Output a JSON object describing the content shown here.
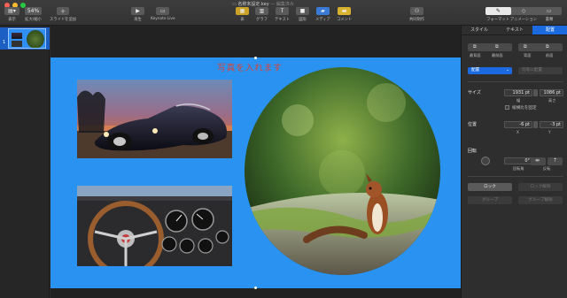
{
  "window": {
    "title": "名称未設定.key",
    "subtitle": "編集済み"
  },
  "toolbar": {
    "view_label": "表示",
    "zoom_value": "54%",
    "zoom_label": "拡大/縮小",
    "add_slide_label": "スライドを追加",
    "play_label": "再生",
    "keynote_live_label": "Keynote Live",
    "table_label": "表",
    "chart_label": "グラフ",
    "text_label": "テキスト",
    "shape_label": "図形",
    "media_label": "メディア",
    "comment_label": "コメント",
    "collaborate_label": "共同制作",
    "format_label": "フォーマット",
    "animate_label": "アニメーション",
    "document_label": "書類"
  },
  "navigator": {
    "selected_slide_number": "1"
  },
  "slide": {
    "title": "写真を入れます",
    "photos": [
      "car-photo",
      "dashboard-photo",
      "squirrel-photo"
    ]
  },
  "inspector": {
    "tabs": [
      "スタイル",
      "テキスト",
      "配置"
    ],
    "active_tab": "配置",
    "arrange_buttons": [
      "最背面",
      "最前面",
      "背面",
      "前面"
    ],
    "align_dropdown": "配置",
    "distribute_dropdown": "均等に配置",
    "size_label": "サイズ",
    "width_value": "1931 pt",
    "width_label": "幅",
    "height_value": "1086 pt",
    "height_label": "高さ",
    "constrain_label": "縦横比を固定",
    "position_label": "位置",
    "x_value": "-6 pt",
    "x_label": "X",
    "y_value": "-3 pt",
    "y_label": "Y",
    "rotate_label": "回転",
    "angle_value": "0°",
    "angle_label": "回転角",
    "flip_label": "反転",
    "lock_label": "ロック",
    "unlock_label": "ロック解除",
    "group_label": "グループ",
    "ungroup_label": "グループ解除"
  },
  "colors": {
    "slide_background": "#2a93f1",
    "title_text": "#d0463e",
    "active_tab": "#1b6ae0",
    "selection": "#1b5fc5"
  }
}
